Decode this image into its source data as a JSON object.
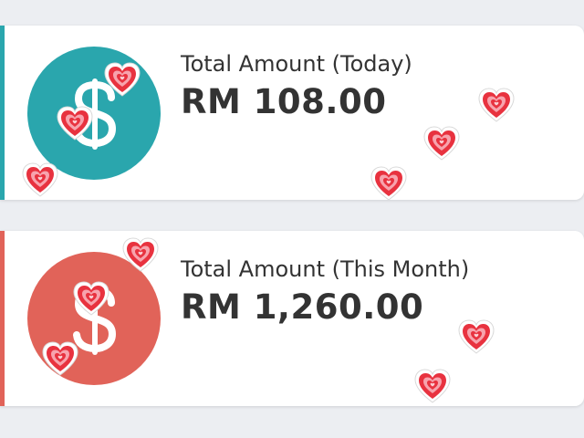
{
  "colors": {
    "today_accent": "#2aa6ad",
    "month_accent": "#e16359",
    "heart": "#e8323f"
  },
  "cards": [
    {
      "label": "Total Amount (Today)",
      "amount": "RM 108.00",
      "icon": "dollar-icon"
    },
    {
      "label": "Total Amount (This Month)",
      "amount": "RM 1,260.00",
      "icon": "dollar-icon"
    }
  ],
  "stickers": {
    "icon": "heart-sticker-icon",
    "count": 11
  }
}
